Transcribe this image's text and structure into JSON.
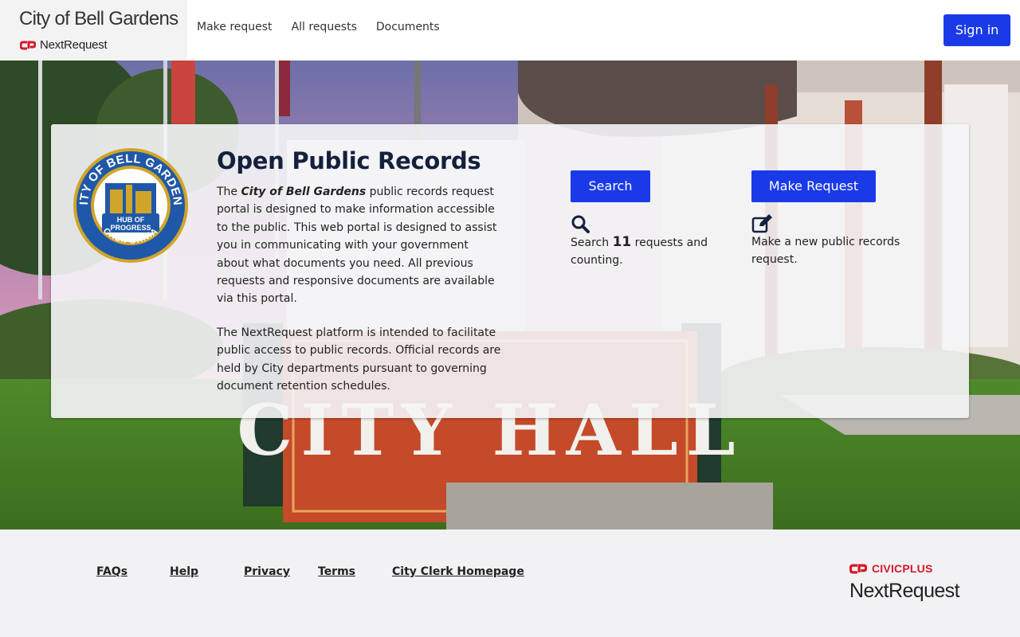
{
  "header": {
    "city_name": "City of Bell Gardens",
    "product_name": "NextRequest",
    "nav": [
      {
        "label": "Make request"
      },
      {
        "label": "All requests"
      },
      {
        "label": "Documents"
      }
    ],
    "sign_in": "Sign in"
  },
  "hero": {
    "background_sign_text": "CITY HALL",
    "seal": {
      "top_text": "CITY OF BELL GARDENS",
      "banner_text_1": "HUB OF",
      "banner_text_2": "PROGRESS",
      "bottom_text": "CALIFORNIA"
    },
    "title": "Open Public Records",
    "intro_prefix": "The ",
    "intro_city": "City of Bell Gardens",
    "intro_rest": " public records request portal is designed to make information accessible to the public. This web portal is designed to assist you in communicating with your government about what documents you need. All previous requests and responsive documents are available via this portal.",
    "platform_text": "The NextRequest platform is intended to facilitate public access to public records. Official records are held by City departments pursuant to governing document retention schedules.",
    "search_button": "Search",
    "search_prefix": "Search ",
    "request_count": "11",
    "search_suffix": " requests and counting.",
    "make_request_button": "Make Request",
    "make_request_text": "Make a new public records request."
  },
  "footer": {
    "links": [
      {
        "label": "FAQs"
      },
      {
        "label": "Help"
      },
      {
        "label": "Privacy"
      },
      {
        "label": "Terms"
      },
      {
        "label": "City Clerk Homepage"
      }
    ],
    "civicplus": "CIVICPLUS",
    "nextrequest": "NextRequest"
  },
  "colors": {
    "primary": "#1a3ae8",
    "brand_red": "#d5182a",
    "title_navy": "#14213d"
  }
}
